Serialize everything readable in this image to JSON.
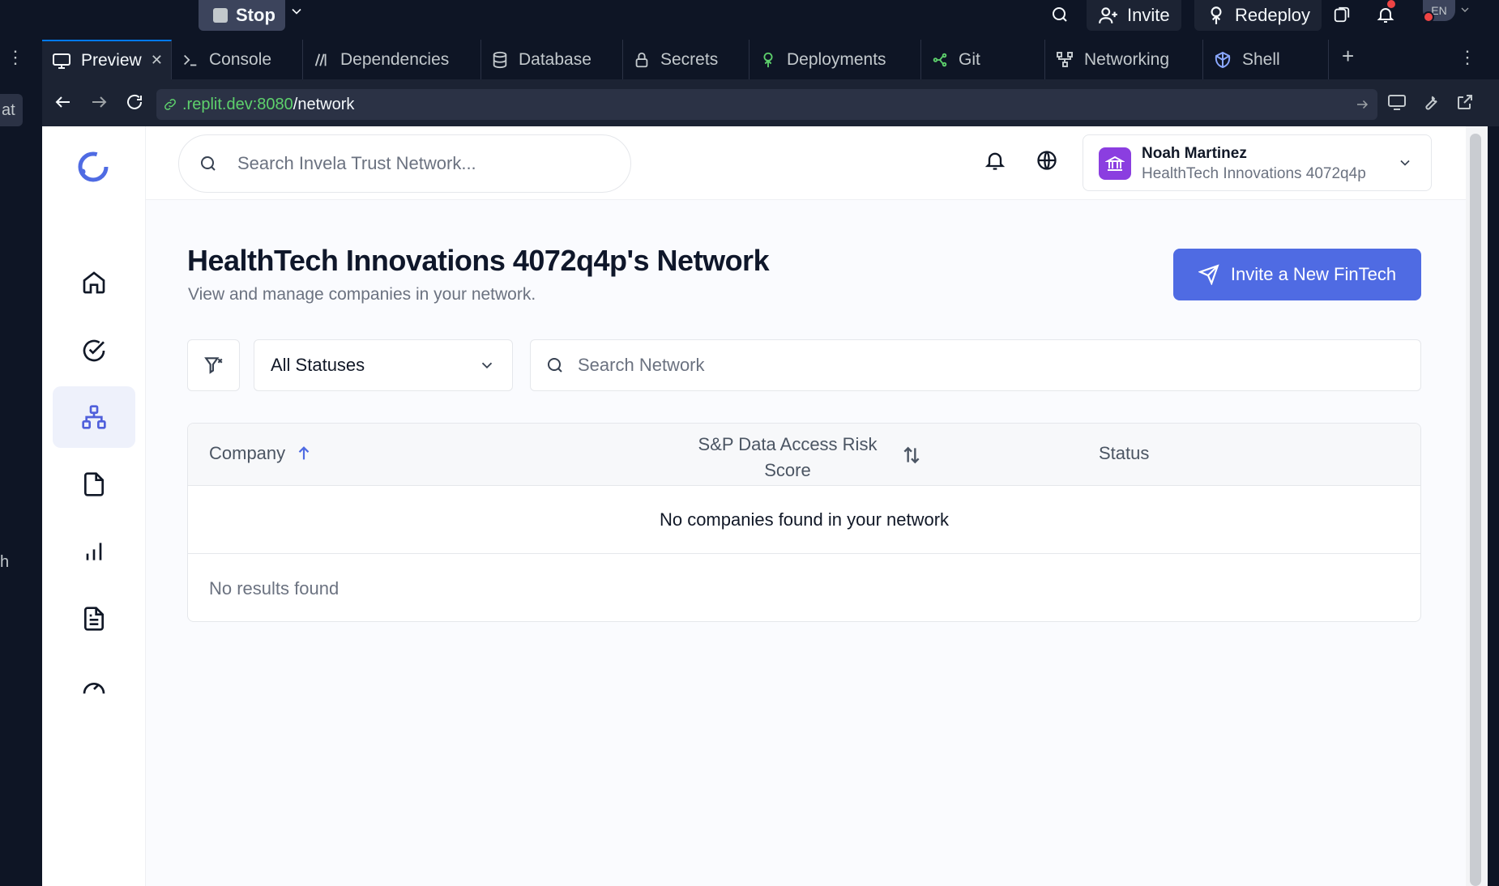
{
  "replit": {
    "stop_label": "Stop",
    "invite_label": "Invite",
    "redeploy_label": "Redeploy",
    "lang_label": "EN",
    "tabs": [
      {
        "label": "Preview",
        "icon": "monitor-icon"
      },
      {
        "label": "Console",
        "icon": "terminal-icon"
      },
      {
        "label": "Dependencies",
        "icon": "dependencies-icon"
      },
      {
        "label": "Database",
        "icon": "database-icon"
      },
      {
        "label": "Secrets",
        "icon": "lock-icon"
      },
      {
        "label": "Deployments",
        "icon": "deployments-icon"
      },
      {
        "label": "Git",
        "icon": "git-icon"
      },
      {
        "label": "Networking",
        "icon": "networking-icon"
      },
      {
        "label": "Shell",
        "icon": "shell-icon"
      }
    ],
    "url_host": ".replit.dev:8080",
    "url_path": "/network",
    "edge_text_top": "at",
    "edge_text_mid": "h"
  },
  "app": {
    "search_placeholder": "Search Invela Trust Network...",
    "user": {
      "name": "Noah Martinez",
      "org": "HealthTech Innovations 4072q4p"
    },
    "page_title": "HealthTech Innovations 4072q4p's Network",
    "page_subtitle": "View and manage companies in your network.",
    "invite_button": "Invite a New FinTech",
    "status_filter": "All Statuses",
    "network_search_placeholder": "Search Network",
    "table": {
      "col_company": "Company",
      "col_score": "S&P Data Access Risk Score",
      "col_status": "Status",
      "empty_message": "No companies found in your network",
      "footer": "No results found"
    }
  },
  "colors": {
    "accent": "#4f6be3",
    "replit_bg": "#0e1525",
    "avatar": "#8b3ee0"
  }
}
